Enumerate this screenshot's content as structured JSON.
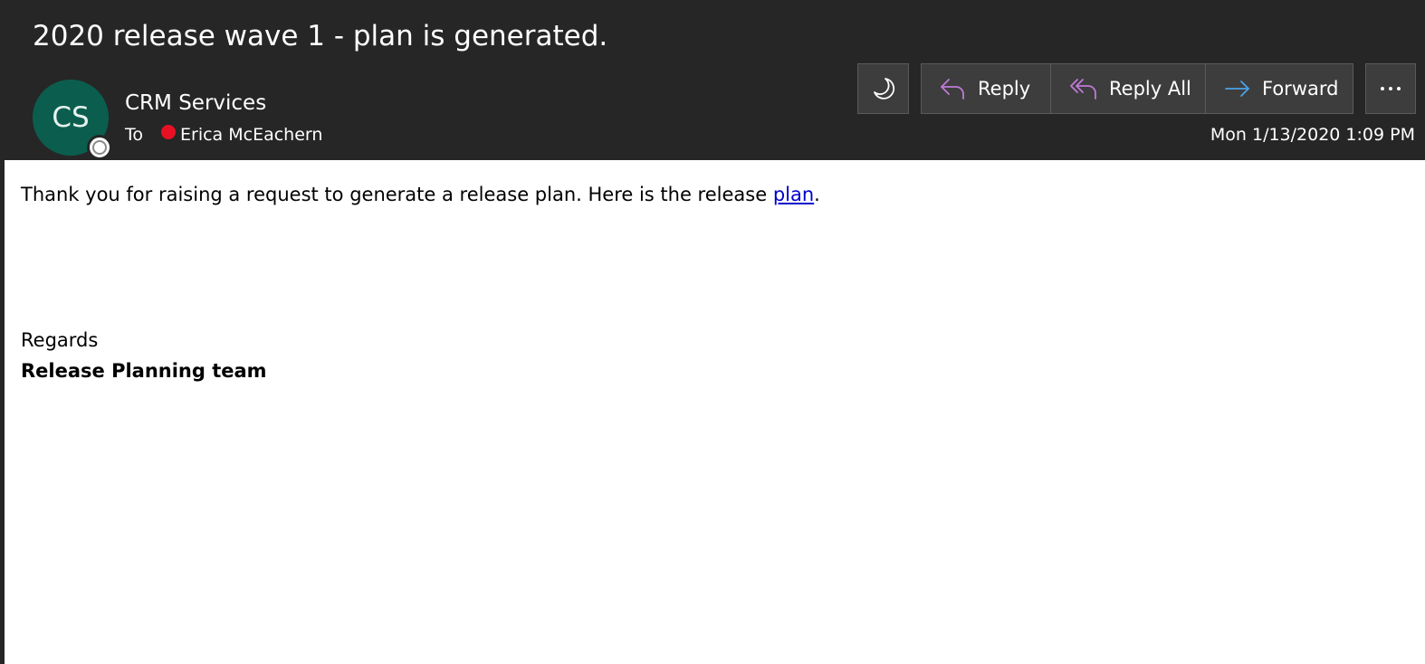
{
  "email": {
    "subject": "2020 release wave 1 - plan is generated.",
    "sender": {
      "initials": "CS",
      "name": "CRM Services",
      "avatar_color": "#0b5e4e"
    },
    "to_label": "To",
    "recipient": {
      "name": "Erica McEachern",
      "presence_color": "#e81123"
    },
    "date": "Mon 1/13/2020 1:09 PM"
  },
  "toolbar": {
    "theme_icon": "moon-icon",
    "reply_label": "Reply",
    "reply_all_label": "Reply All",
    "forward_label": "Forward",
    "reply_icon_color": "#c07ad8",
    "forward_icon_color": "#4aa3e8",
    "more_icon": "ellipsis-icon"
  },
  "body": {
    "line1_text": "Thank you for raising a request to generate a release plan. Here is the release ",
    "link_text": "plan",
    "line1_end": ".",
    "regards": "Regards",
    "team": "Release Planning team"
  }
}
